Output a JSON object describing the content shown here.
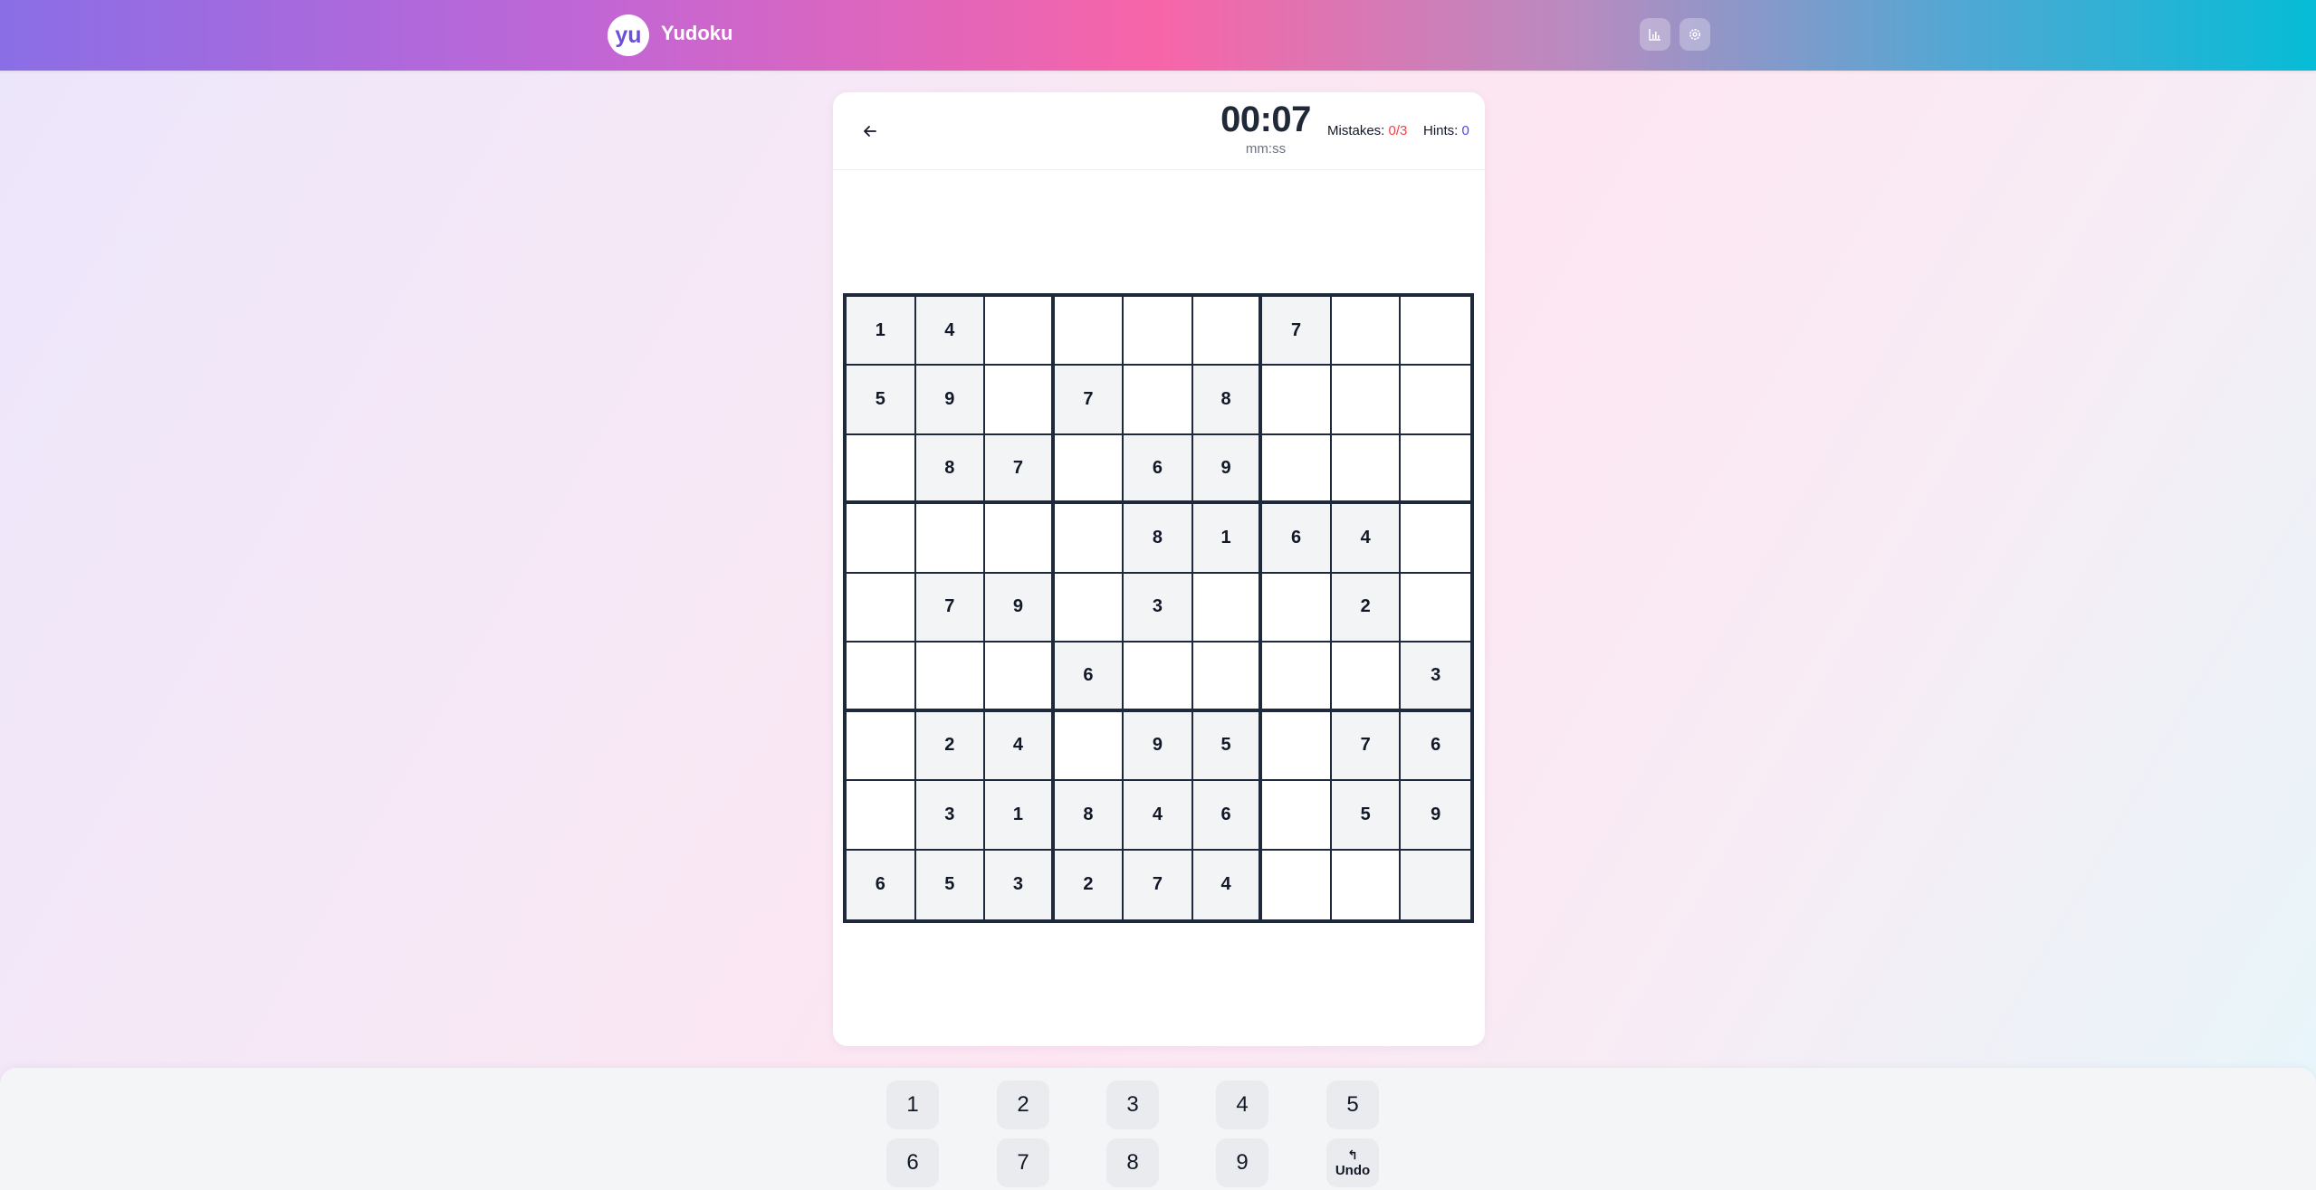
{
  "app": {
    "logo_text": "yu",
    "title": "Yudoku"
  },
  "header_icons": [
    "stats-icon",
    "settings-icon"
  ],
  "game": {
    "timer": "00:07",
    "timer_unit": "mm:ss",
    "mistakes_label": "Mistakes:",
    "mistakes_value": "0/3",
    "hints_label": "Hints:",
    "hints_value": "0"
  },
  "board": [
    [
      "1",
      "4",
      "",
      "",
      "",
      "",
      "7",
      "",
      ""
    ],
    [
      "5",
      "9",
      "",
      "7",
      "",
      "8",
      "",
      "",
      ""
    ],
    [
      "",
      "8",
      "7",
      "",
      "6",
      "9",
      "",
      "",
      ""
    ],
    [
      "",
      "",
      "",
      "",
      "8",
      "1",
      "6",
      "4",
      ""
    ],
    [
      "",
      "7",
      "9",
      "",
      "3",
      "",
      "",
      "2",
      ""
    ],
    [
      "",
      "",
      "",
      "6",
      "",
      "",
      "",
      "",
      "3"
    ],
    [
      "",
      "2",
      "4",
      "",
      "9",
      "5",
      "",
      "7",
      "6"
    ],
    [
      "",
      "3",
      "1",
      "8",
      "4",
      "6",
      "",
      "5",
      "9"
    ],
    [
      "6",
      "5",
      "3",
      "2",
      "7",
      "4",
      "",
      "",
      ""
    ]
  ],
  "shaded_cells": [
    [
      1,
      1,
      0,
      0,
      0,
      0,
      1,
      0,
      0
    ],
    [
      1,
      1,
      0,
      1,
      0,
      1,
      0,
      0,
      0
    ],
    [
      0,
      1,
      1,
      0,
      1,
      1,
      0,
      0,
      0
    ],
    [
      0,
      0,
      0,
      0,
      1,
      1,
      1,
      1,
      0
    ],
    [
      0,
      1,
      1,
      0,
      1,
      0,
      0,
      1,
      0
    ],
    [
      0,
      0,
      0,
      1,
      0,
      0,
      0,
      0,
      1
    ],
    [
      0,
      1,
      1,
      0,
      1,
      1,
      0,
      1,
      1
    ],
    [
      0,
      1,
      1,
      1,
      1,
      1,
      0,
      1,
      1
    ],
    [
      1,
      1,
      1,
      1,
      1,
      1,
      0,
      0,
      1
    ]
  ],
  "keypad": {
    "row1": [
      "1",
      "2",
      "3",
      "4",
      "5"
    ],
    "row2": [
      "6",
      "7",
      "8",
      "9"
    ],
    "undo_label": "Undo"
  },
  "colors": {
    "mistakes": "#ef4444",
    "hints": "#4f46e5",
    "board_border": "#1e293b",
    "given_cell": "#f3f4f6"
  }
}
